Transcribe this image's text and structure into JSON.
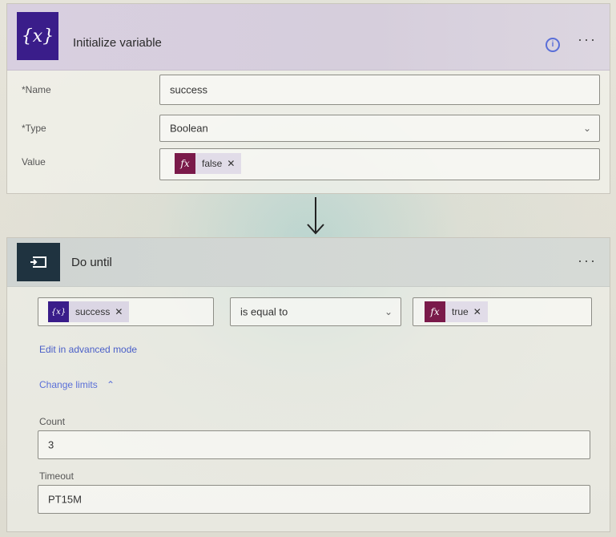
{
  "init_var": {
    "title": "Initialize variable",
    "icon": "variable-icon",
    "name_label": "*Name",
    "name_value": "success",
    "type_label": "*Type",
    "type_value": "Boolean",
    "value_label": "Value",
    "value_token": {
      "text": "false",
      "icon": "fx-icon",
      "color": "#7a1a4a"
    }
  },
  "do_until": {
    "title": "Do until",
    "icon": "loop-icon",
    "condition_left": {
      "text": "success",
      "icon": "variable-icon",
      "color": "#3a1d8a"
    },
    "operator": "is equal to",
    "condition_right": {
      "text": "true",
      "icon": "fx-icon",
      "color": "#7a1a4a"
    },
    "advanced_link": "Edit in advanced mode",
    "change_limits": "Change limits",
    "count_label": "Count",
    "count_value": "3",
    "timeout_label": "Timeout",
    "timeout_value": "PT15M"
  },
  "colors": {
    "accent_link": "#4a5fc8",
    "variable_purple": "#3a1d8a",
    "expression_maroon": "#7a1a4a",
    "loop_dark": "#1f3340"
  }
}
